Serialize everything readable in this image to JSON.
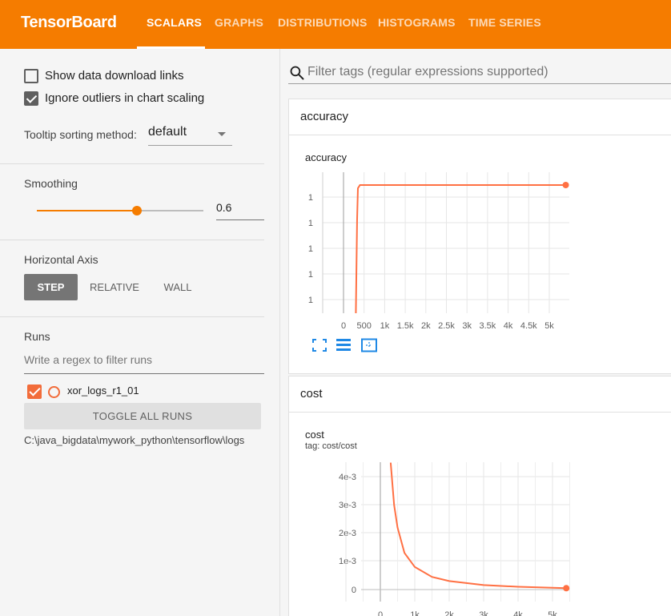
{
  "header": {
    "brand": "TensorBoard",
    "tabs": [
      {
        "label": "SCALARS",
        "active": true
      },
      {
        "label": "GRAPHS"
      },
      {
        "label": "DISTRIBUTIONS"
      },
      {
        "label": "HISTOGRAMS"
      },
      {
        "label": "TIME SERIES"
      }
    ],
    "color": "#f57c00"
  },
  "sidebar": {
    "show_download_links": {
      "label": "Show data download links",
      "checked": false
    },
    "ignore_outliers": {
      "label": "Ignore outliers in chart scaling",
      "checked": true
    },
    "tooltip_sort": {
      "label": "Tooltip sorting method:",
      "value": "default"
    },
    "smoothing": {
      "label": "Smoothing",
      "value": "0.6",
      "fraction": 0.6
    },
    "horizontal_axis": {
      "label": "Horizontal Axis",
      "options": [
        "STEP",
        "RELATIVE",
        "WALL"
      ],
      "selected": "STEP"
    },
    "runs": {
      "label": "Runs",
      "filter_placeholder": "Write a regex to filter runs",
      "items": [
        {
          "name": "xor_logs_r1_01",
          "checked": true,
          "color": "#f26c3a"
        }
      ],
      "toggle_all_label": "TOGGLE ALL RUNS",
      "logdir": "C:\\java_bigdata\\mywork_python\\tensorflow\\logs"
    }
  },
  "main": {
    "filter_placeholder": "Filter tags (regular expressions supported)",
    "cards": [
      {
        "header": "accuracy",
        "chart_title": "accuracy",
        "tag": ""
      },
      {
        "header": "cost",
        "chart_title": "cost",
        "tag": "tag: cost/cost"
      }
    ]
  },
  "chart_data": [
    {
      "type": "line",
      "title": "accuracy",
      "x_ticks": [
        "0",
        "500",
        "1k",
        "1.5k",
        "2k",
        "2.5k",
        "3k",
        "3.5k",
        "4k",
        "4.5k",
        "5k"
      ],
      "y_ticks": [
        "1",
        "1",
        "1",
        "1",
        "1"
      ],
      "xlim": [
        -300,
        5500
      ],
      "series": [
        {
          "values": [
            [
              300,
              0.0
            ],
            [
              350,
              0.5
            ],
            [
              420,
              0.99
            ],
            [
              500,
              1.0
            ],
            [
              5400,
              1.0
            ]
          ],
          "color": "#ff7043"
        }
      ]
    },
    {
      "type": "line",
      "title": "cost",
      "x_ticks": [
        "0",
        "1k",
        "2k",
        "3k",
        "4k",
        "5k"
      ],
      "y_ticks": [
        "4e-3",
        "3e-3",
        "2e-3",
        "1e-3",
        "0"
      ],
      "xlim": [
        -500,
        5500
      ],
      "ylim": [
        -0.0002,
        0.0045
      ],
      "series": [
        {
          "values": [
            [
              300,
              0.0045
            ],
            [
              400,
              0.003
            ],
            [
              500,
              0.0022
            ],
            [
              700,
              0.0013
            ],
            [
              1000,
              0.0008
            ],
            [
              1500,
              0.00045
            ],
            [
              2000,
              0.0003
            ],
            [
              3000,
              0.00016
            ],
            [
              4000,
              0.0001
            ],
            [
              5400,
              5e-05
            ]
          ],
          "color": "#ff7043"
        }
      ]
    }
  ]
}
